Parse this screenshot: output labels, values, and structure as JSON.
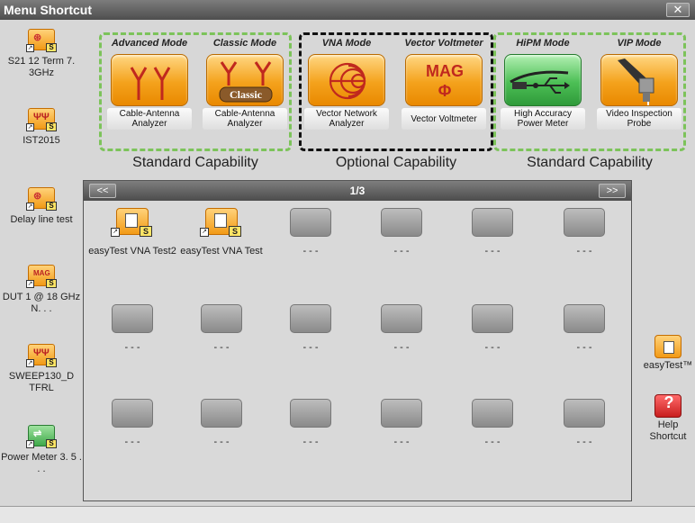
{
  "window": {
    "title": "Menu Shortcut",
    "close_glyph": "✕"
  },
  "left_shortcuts": [
    {
      "label": "S21 12 Term 7. 3GHz",
      "icon": "vna-shortcut-icon",
      "style": "orange"
    },
    {
      "label": "IST2015",
      "icon": "antenna-shortcut-icon",
      "style": "orange"
    },
    {
      "label": "Delay line test",
      "icon": "vna-shortcut-icon",
      "style": "orange"
    },
    {
      "label": "DUT 1 @ 18 GHz N. . .",
      "icon": "mag-shortcut-icon",
      "style": "orange"
    },
    {
      "label": "SWEEP130_D TFRL",
      "icon": "antenna-shortcut-icon",
      "style": "orange"
    },
    {
      "label": "Power Meter 3. 5 . . .",
      "icon": "power-meter-shortcut-icon",
      "style": "green"
    }
  ],
  "apps": [
    {
      "mode": "Advanced Mode",
      "name": "Cable-Antenna Analyzer",
      "icon": "antenna-icon",
      "style": "orange"
    },
    {
      "mode": "Classic Mode",
      "name": "Cable-Antenna Analyzer",
      "icon": "classic-antenna-icon",
      "style": "orange",
      "badge": "Classic"
    },
    {
      "mode": "VNA Mode",
      "name": "Vector Network Analyzer",
      "icon": "smith-chart-icon",
      "style": "orange"
    },
    {
      "mode": "Vector Voltmeter",
      "name": "Vector Voltmeter",
      "icon": "mag-phase-icon",
      "style": "orange",
      "glyph_top": "MAG",
      "glyph_bottom": "Φ"
    },
    {
      "mode": "HiPM Mode",
      "name": "High Accuracy Power Meter",
      "icon": "usb-power-sensor-icon",
      "style": "green"
    },
    {
      "mode": "VIP Mode",
      "name": "Video Inspection Probe",
      "icon": "inspection-probe-icon",
      "style": "orange"
    }
  ],
  "capability_labels": {
    "left": "Standard Capability",
    "middle": "Optional Capability",
    "right": "Standard Capability"
  },
  "panel": {
    "page_indicator": "1/3",
    "prev_glyph": "<<",
    "next_glyph": ">>",
    "slots": [
      "easyTest VNA Test2",
      "easyTest VNA Test",
      "- - -",
      "- - -",
      "- - -",
      "- - -",
      "- - -",
      "- - -",
      "- - -",
      "- - -",
      "- - -",
      "- - -",
      "- - -",
      "- - -",
      "- - -",
      "- - -",
      "- - -",
      "- - -"
    ]
  },
  "right_items": {
    "easytest_label": "easyTest™",
    "help_label": "Help Shortcut",
    "help_glyph": "?"
  },
  "colors": {
    "standard_border": "#7cc35a",
    "optional_border": "#111111",
    "tile_orange": "#f29a16",
    "tile_green": "#4cbf55"
  }
}
